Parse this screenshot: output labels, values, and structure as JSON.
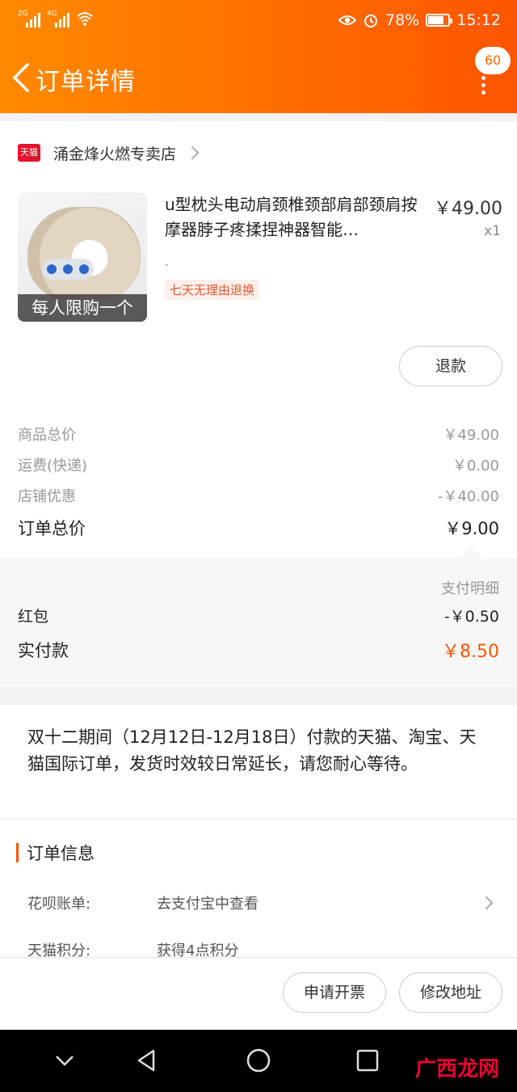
{
  "status_bar": {
    "net1": "2G",
    "net2": "4G",
    "battery": "78%",
    "battery_level": 0.78,
    "time": "15:12"
  },
  "header": {
    "title": "订单详情",
    "message_count": "60"
  },
  "shop": {
    "badge": "天猫",
    "name": "涌金烽火燃专卖店"
  },
  "product": {
    "image_caption": "每人限购一个",
    "title": "u型枕头电动肩颈椎颈部肩部颈肩按摩器脖子疼揉捏神器智能…",
    "sku": ".",
    "tag": "七天无理由退换",
    "price": "￥49.00",
    "quantity": "x1",
    "refund_label": "退款"
  },
  "summary": [
    {
      "label": "商品总价",
      "value": "￥49.00"
    },
    {
      "label": "运费(快递)",
      "value": "￥0.00"
    },
    {
      "label": "店铺优惠",
      "value": "-￥40.00"
    }
  ],
  "order_total": {
    "label": "订单总价",
    "value": "￥9.00"
  },
  "payment": {
    "detail_label": "支付明细",
    "red_packet": {
      "label": "红包",
      "value": "-￥0.50"
    },
    "actual": {
      "label": "实付款",
      "value": "￥8.50"
    }
  },
  "notice": "双十二期间（12月12日-12月18日）付款的天猫、淘宝、天猫国际订单，发货时效较日常延长，请您耐心等待。",
  "order_info": {
    "title": "订单信息",
    "rows": [
      {
        "label": "花呗账单:",
        "value": "去支付宝中查看"
      },
      {
        "label": "天猫积分:",
        "value": "获得4点积分"
      }
    ]
  },
  "actions": {
    "invoice": "申请开票",
    "change_address": "修改地址"
  },
  "watermark": "广西龙网",
  "colors": {
    "header_gradient_start": "#ff8a00",
    "header_gradient_end": "#ff5500",
    "accent": "#ff5500",
    "tmall_red": "#e4122b"
  }
}
